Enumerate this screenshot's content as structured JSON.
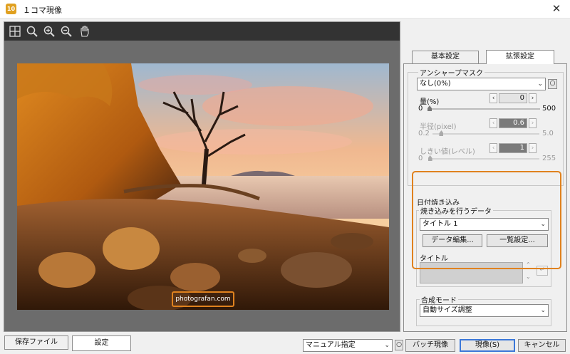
{
  "window": {
    "title": "１コマ現像",
    "icon_label": "10",
    "close_glyph": "✕"
  },
  "toolbar": {
    "tools": [
      "grid-icon",
      "zoom-fit-icon",
      "zoom-in-icon",
      "zoom-out-icon",
      "hand-icon"
    ]
  },
  "preview": {
    "watermark_text": "photografan.com"
  },
  "tabs": {
    "basic_label": "基本設定",
    "extended_label": "拡張設定"
  },
  "unsharp": {
    "group_label": "アンシャープマスク",
    "preset_value": "なし(0%)",
    "amount": {
      "label": "量(%)",
      "value": "0",
      "min": "0",
      "max": "500",
      "level": 0
    },
    "radius": {
      "label": "半径(pixel)",
      "value": "0.6",
      "min": "0.2",
      "max": "5.0",
      "level": 0.083
    },
    "threshold": {
      "label": "しきい値(レベル)",
      "value": "1",
      "min": "0",
      "max": "255",
      "level": 0.004
    }
  },
  "date_imprint": {
    "group_label": "日付焼き込み",
    "data_label": "焼き込みを行うデータ",
    "data_value": "タイトル 1",
    "edit_button": "データ編集...",
    "list_button": "一覧設定...",
    "title_label": "タイトル"
  },
  "compose": {
    "label": "合成モード",
    "value": "自動サイズ調整"
  },
  "bottom": {
    "save_file_tab": "保存ファイル",
    "settings_tab": "設定",
    "mode_value": "マニュアル指定",
    "batch_button": "バッチ現像",
    "develop_button": "現像(S)",
    "cancel_button": "キャンセル"
  },
  "colors": {
    "highlight": "#e0821e",
    "primary_border": "#3c78d8"
  }
}
